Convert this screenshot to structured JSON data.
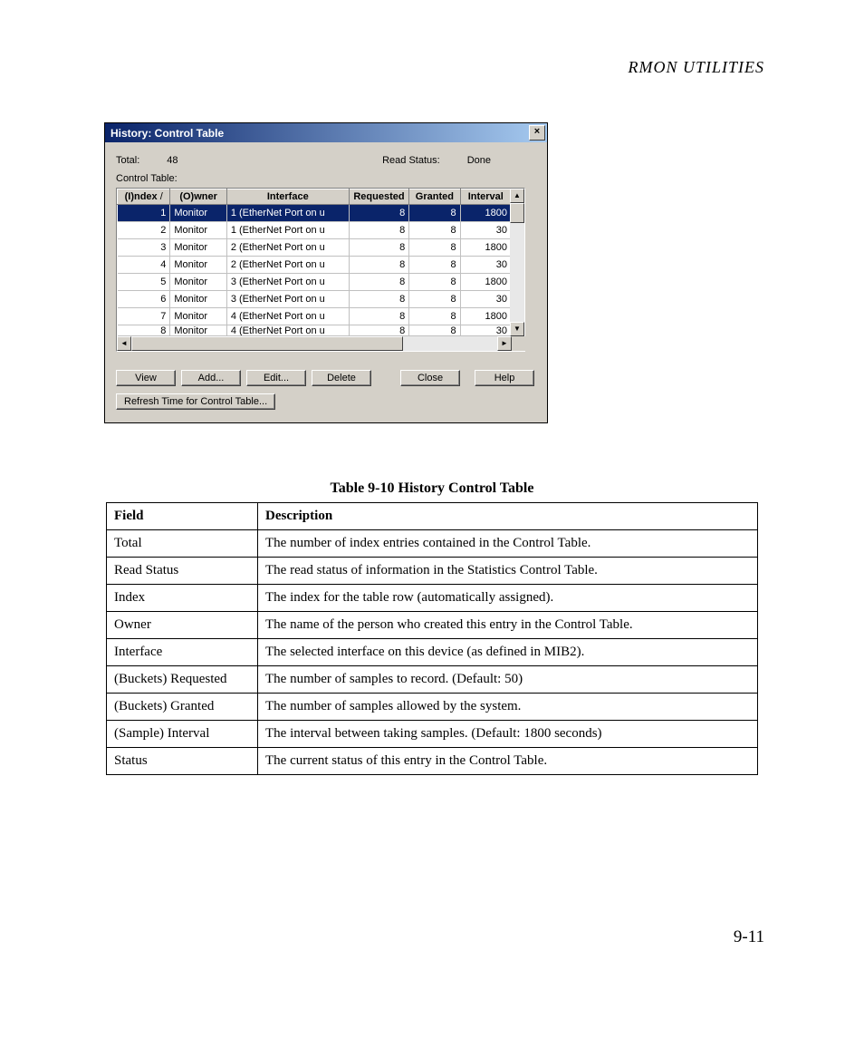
{
  "page": {
    "header": "RMON UTILITIES",
    "number": "9-11"
  },
  "dialog": {
    "title": "History: Control Table",
    "total_label": "Total:",
    "total_value": "48",
    "read_status_label": "Read Status:",
    "read_status_value": "Done",
    "control_table_label": "Control Table:",
    "columns": [
      "(I)ndex",
      "(O)wner",
      "Interface",
      "Requested",
      "Granted",
      "Interval"
    ],
    "rows": [
      {
        "index": "1",
        "owner": "Monitor",
        "interface": "1 (EtherNet Port on u",
        "requested": "8",
        "granted": "8",
        "interval": "1800",
        "selected": true
      },
      {
        "index": "2",
        "owner": "Monitor",
        "interface": "1 (EtherNet Port on u",
        "requested": "8",
        "granted": "8",
        "interval": "30"
      },
      {
        "index": "3",
        "owner": "Monitor",
        "interface": "2 (EtherNet Port on u",
        "requested": "8",
        "granted": "8",
        "interval": "1800"
      },
      {
        "index": "4",
        "owner": "Monitor",
        "interface": "2 (EtherNet Port on u",
        "requested": "8",
        "granted": "8",
        "interval": "30"
      },
      {
        "index": "5",
        "owner": "Monitor",
        "interface": "3 (EtherNet Port on u",
        "requested": "8",
        "granted": "8",
        "interval": "1800"
      },
      {
        "index": "6",
        "owner": "Monitor",
        "interface": "3 (EtherNet Port on u",
        "requested": "8",
        "granted": "8",
        "interval": "30"
      },
      {
        "index": "7",
        "owner": "Monitor",
        "interface": "4 (EtherNet Port on u",
        "requested": "8",
        "granted": "8",
        "interval": "1800"
      },
      {
        "index": "8",
        "owner": "Monitor",
        "interface": "4 (EtherNet Port on u",
        "requested": "8",
        "granted": "8",
        "interval": "30",
        "partial": true
      }
    ],
    "buttons": [
      "View",
      "Add...",
      "Edit...",
      "Delete",
      "Close",
      "Help"
    ],
    "refresh_button": "Refresh Time for Control Table..."
  },
  "doc_table": {
    "caption": "Table 9-10  History Control Table",
    "headers": [
      "Field",
      "Description"
    ],
    "rows": [
      {
        "field": "Total",
        "desc": "The number of index entries contained in the Control Table."
      },
      {
        "field": "Read Status",
        "desc": "The read status of information in the Statistics Control Table."
      },
      {
        "field": "Index",
        "desc": "The index for the table row (automatically assigned)."
      },
      {
        "field": "Owner",
        "desc": "The name of the person who created this entry in the Control Table."
      },
      {
        "field": "Interface",
        "desc": "The selected interface on this device (as defined in MIB2)."
      },
      {
        "field": "(Buckets) Requested",
        "desc": "The number of samples to record. (Default: 50)"
      },
      {
        "field": "(Buckets) Granted",
        "desc": "The number of samples allowed by the system."
      },
      {
        "field": "(Sample) Interval",
        "desc": "The interval between taking samples. (Default: 1800 seconds)"
      },
      {
        "field": "Status",
        "desc": "The current status of this entry in the Control Table."
      }
    ]
  }
}
